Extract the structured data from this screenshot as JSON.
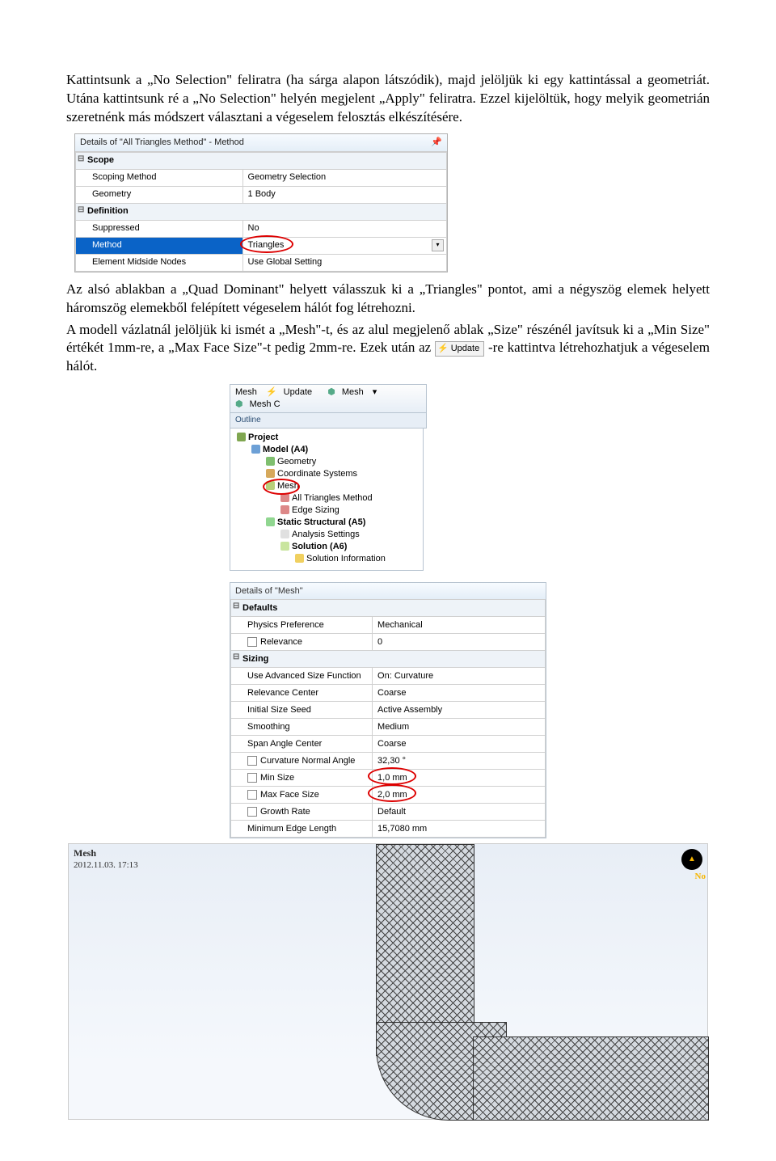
{
  "para1": "Kattintsunk a „No Selection\" feliratra (ha sárga alapon látszódik), majd jelöljük ki egy kattintással a geometriát. Utána kattintsunk ré a „No Selection\" helyén megjelent „Apply\" feliratra. Ezzel kijelöltük, hogy melyik geometrián szeretnénk más módszert választani a végeselem felosztás elkészítésére.",
  "para2": "Az alsó ablakban a „Quad Dominant\" helyett válasszuk ki a „Triangles\" pontot, ami a négyszög elemek helyett háromszög elemekből felépített végeselem hálót fog létrehozni.",
  "para3a": "A modell vázlatnál jelöljük ki ismét a „Mesh\"-t, és az alul megjelenő ablak „Size\" részénél javítsuk ki a „Min Size\" értékét 1mm-re, a „Max Face Size\"-t pedig 2mm-re. Ezek után az ",
  "para3b": "-re kattintva létrehozhatjuk a végeselem hálót.",
  "updateBtn": "Update",
  "p1": {
    "title": "Details of \"All Triangles Method\" - Method",
    "g1": "Scope",
    "r1k": "Scoping Method",
    "r1v": "Geometry Selection",
    "r2k": "Geometry",
    "r2v": "1 Body",
    "g2": "Definition",
    "r3k": "Suppressed",
    "r3v": "No",
    "r4k": "Method",
    "r4v": "Triangles",
    "r5k": "Element Midside Nodes",
    "r5v": "Use Global Setting"
  },
  "tbar": {
    "mesh": "Mesh",
    "update": "Update",
    "meshbtn": "Mesh",
    "meshctl": "Mesh C"
  },
  "outline": "Outline",
  "tree": {
    "project": "Project",
    "model": "Model (A4)",
    "geometry": "Geometry",
    "cs": "Coordinate Systems",
    "mesh": "Mesh",
    "allTri": "All Triangles Method",
    "edge": "Edge Sizing",
    "ss": "Static Structural (A5)",
    "as": "Analysis Settings",
    "sol": "Solution (A6)",
    "si": "Solution Information"
  },
  "p2": {
    "title": "Details of \"Mesh\"",
    "g1": "Defaults",
    "r1k": "Physics Preference",
    "r1v": "Mechanical",
    "r2k": "Relevance",
    "r2v": "0",
    "g2": "Sizing",
    "r3k": "Use Advanced Size Function",
    "r3v": "On: Curvature",
    "r4k": "Relevance Center",
    "r4v": "Coarse",
    "r5k": "Initial Size Seed",
    "r5v": "Active Assembly",
    "r6k": "Smoothing",
    "r6v": "Medium",
    "r7k": "Span Angle Center",
    "r7v": "Coarse",
    "r8k": "Curvature Normal Angle",
    "r8v": "32,30 °",
    "r9k": "Min Size",
    "r9v": "1,0 mm",
    "r10k": "Max Face Size",
    "r10v": "2,0 mm",
    "r11k": "Growth Rate",
    "r11v": "Default",
    "r12k": "Minimum Edge Length",
    "r12v": "15,7080 mm"
  },
  "meshPrev": {
    "title": "Mesh",
    "ts": "2012.11.03. 17:13",
    "badge": "No"
  }
}
